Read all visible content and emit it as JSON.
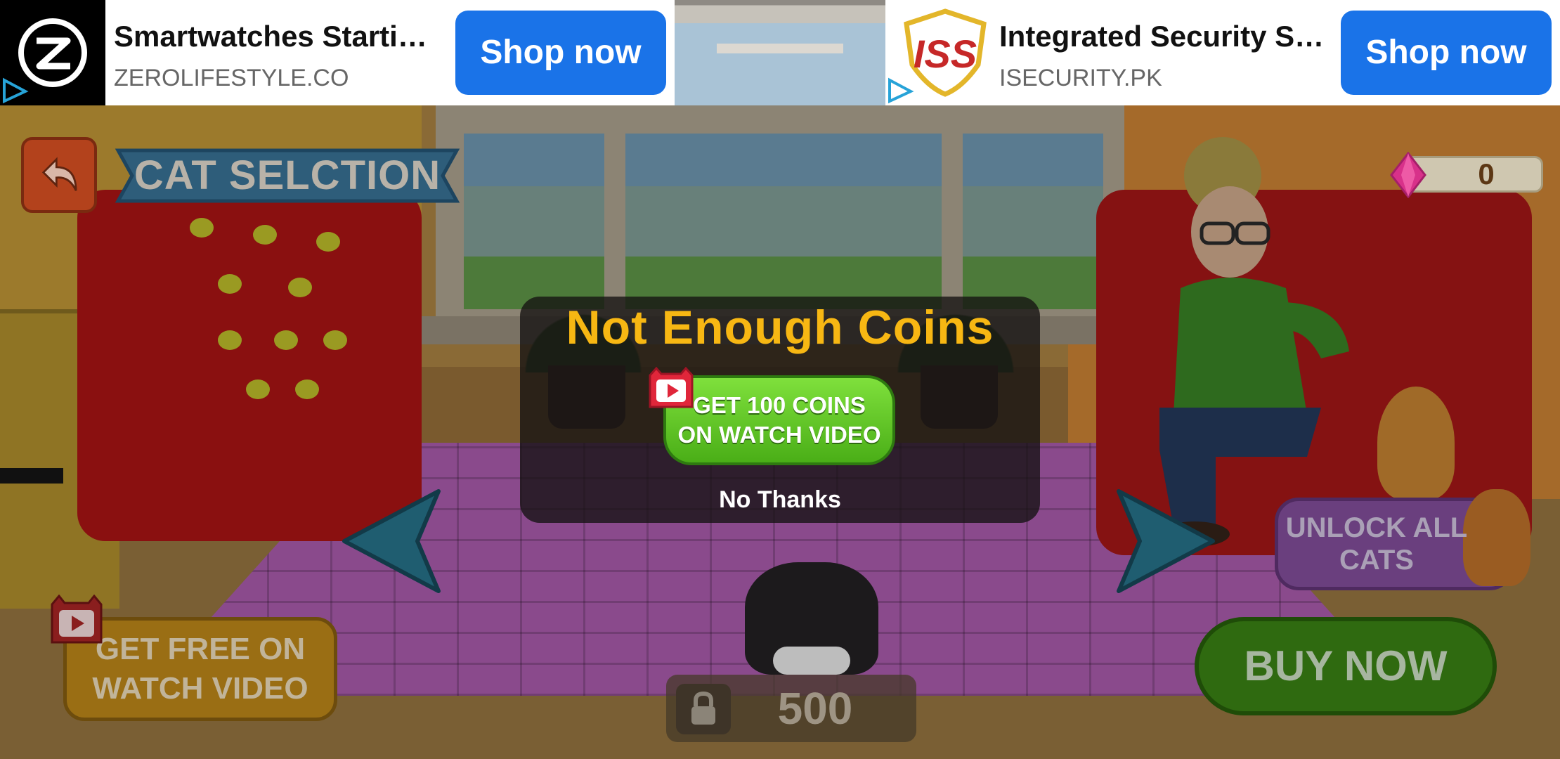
{
  "ads": [
    {
      "title": "Smartwatches Starti…",
      "domain": "ZEROLIFESTYLE.CO",
      "cta": "Shop now",
      "logo": "zero-lifestyle-logo"
    },
    {
      "title": "Integrated Security S…",
      "domain": "ISECURITY.PK",
      "cta": "Shop now",
      "logo": "iss-logo",
      "logo_text": "ISS"
    }
  ],
  "header": {
    "back_icon": "back-arrow-icon",
    "title": "CAT SELCTION"
  },
  "currency": {
    "gem_icon": "pink-gem-icon",
    "gems": "0"
  },
  "navigation": {
    "prev_icon": "left-triangle-arrow-icon",
    "next_icon": "right-triangle-arrow-icon"
  },
  "buttons": {
    "unlock_all": "UNLOCK ALL\nCATS",
    "free_video": "GET FREE ON\nWATCH VIDEO",
    "buy_now": "BUY NOW"
  },
  "price": {
    "lock_icon": "lock-icon",
    "value": "500"
  },
  "dialog": {
    "title": "Not Enough Coins",
    "watch_button": "GET 100 COINS\nON WATCH VIDEO",
    "dismiss": "No Thanks",
    "badge_icon": "video-play-icon"
  },
  "colors": {
    "dialog_title": "#f7b713",
    "watch_button": "#5cc21f",
    "ad_cta": "#1a73e8",
    "buy_now": "#2f6a10"
  }
}
